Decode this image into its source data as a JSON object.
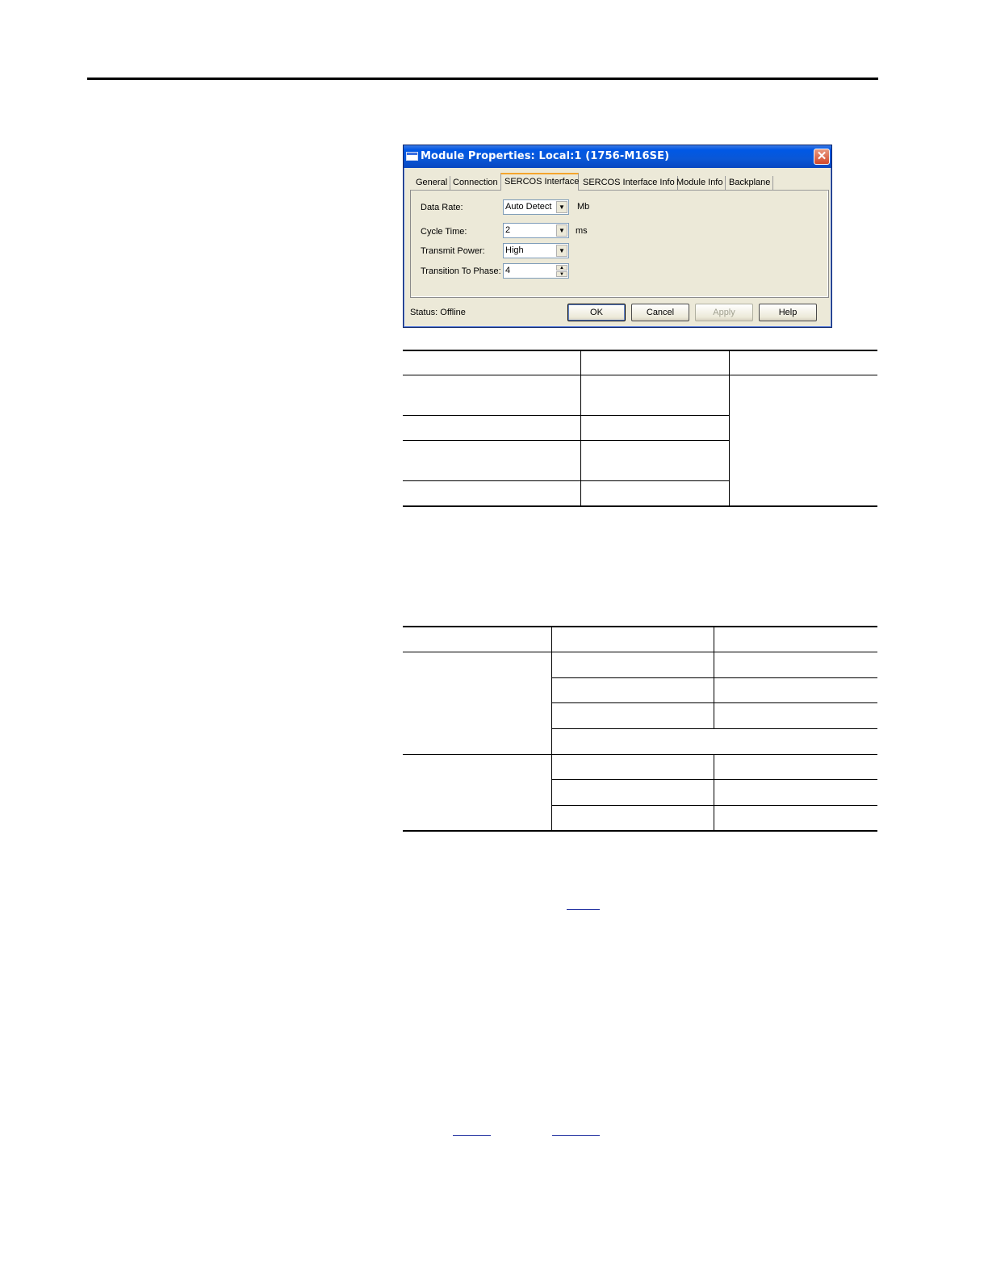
{
  "dialog": {
    "title": "Module Properties: Local:1 (1756-M16SE)",
    "close_glyph": "✕",
    "tabs": [
      "General",
      "Connection",
      "SERCOS Interface",
      "SERCOS Interface Info",
      "Module Info",
      "Backplane"
    ],
    "active_tab": "SERCOS Interface",
    "fields": {
      "data_rate": {
        "label": "Data Rate:",
        "value": "Auto Detect",
        "unit": "Mb"
      },
      "cycle_time": {
        "label": "Cycle Time:",
        "value": "2",
        "unit": "ms"
      },
      "transmit_power": {
        "label": "Transmit Power:",
        "value": "High"
      },
      "transition_to_phase": {
        "label": "Transition To Phase:",
        "value": "4"
      }
    },
    "status": "Status:  Offline",
    "buttons": {
      "ok": "OK",
      "cancel": "Cancel",
      "apply": "Apply",
      "help": "Help"
    }
  }
}
